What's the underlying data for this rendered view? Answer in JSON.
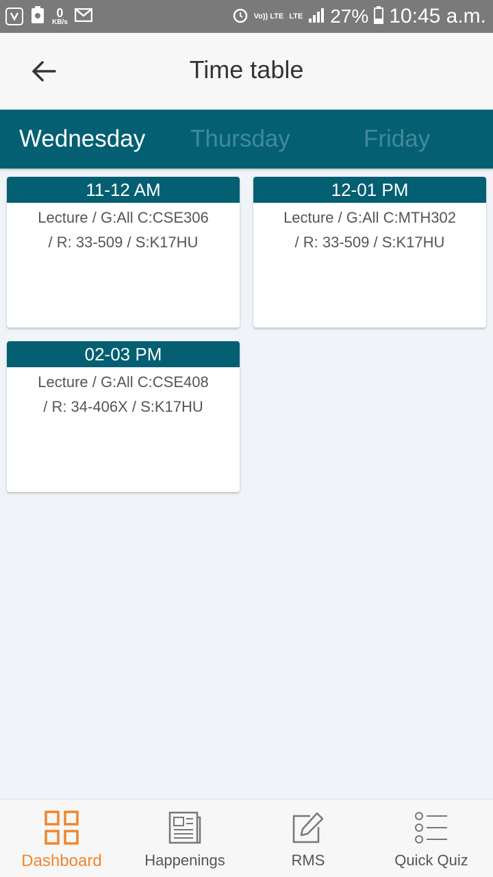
{
  "status_bar": {
    "data_rate": "0",
    "data_unit": "KB/s",
    "volte": "Vo)) LTE",
    "network": "LTE",
    "battery": "27%",
    "time": "10:45 a.m."
  },
  "header": {
    "title": "Time table"
  },
  "tabs": [
    {
      "label": "Wednesday",
      "active": true
    },
    {
      "label": "Thursday",
      "active": false
    },
    {
      "label": "Friday",
      "active": false
    }
  ],
  "classes": [
    {
      "time": "11-12 AM",
      "line1": "Lecture / G:All C:CSE306",
      "line2": "/ R: 33-509 / S:K17HU"
    },
    {
      "time": "12-01 PM",
      "line1": "Lecture / G:All C:MTH302",
      "line2": "/ R: 33-509 / S:K17HU"
    },
    {
      "time": "02-03 PM",
      "line1": "Lecture / G:All C:CSE408",
      "line2": "/ R: 34-406X / S:K17HU"
    }
  ],
  "bottom_nav": [
    {
      "label": "Dashboard",
      "icon": "dashboard-grid-icon",
      "active": true
    },
    {
      "label": "Happenings",
      "icon": "newspaper-icon",
      "active": false
    },
    {
      "label": "RMS",
      "icon": "edit-icon",
      "active": false
    },
    {
      "label": "Quick Quiz",
      "icon": "list-icon",
      "active": false
    }
  ],
  "colors": {
    "primary": "#045f72",
    "accent": "#f0852d",
    "background": "#f0f4f8",
    "status_bar": "#7a7a7a"
  }
}
